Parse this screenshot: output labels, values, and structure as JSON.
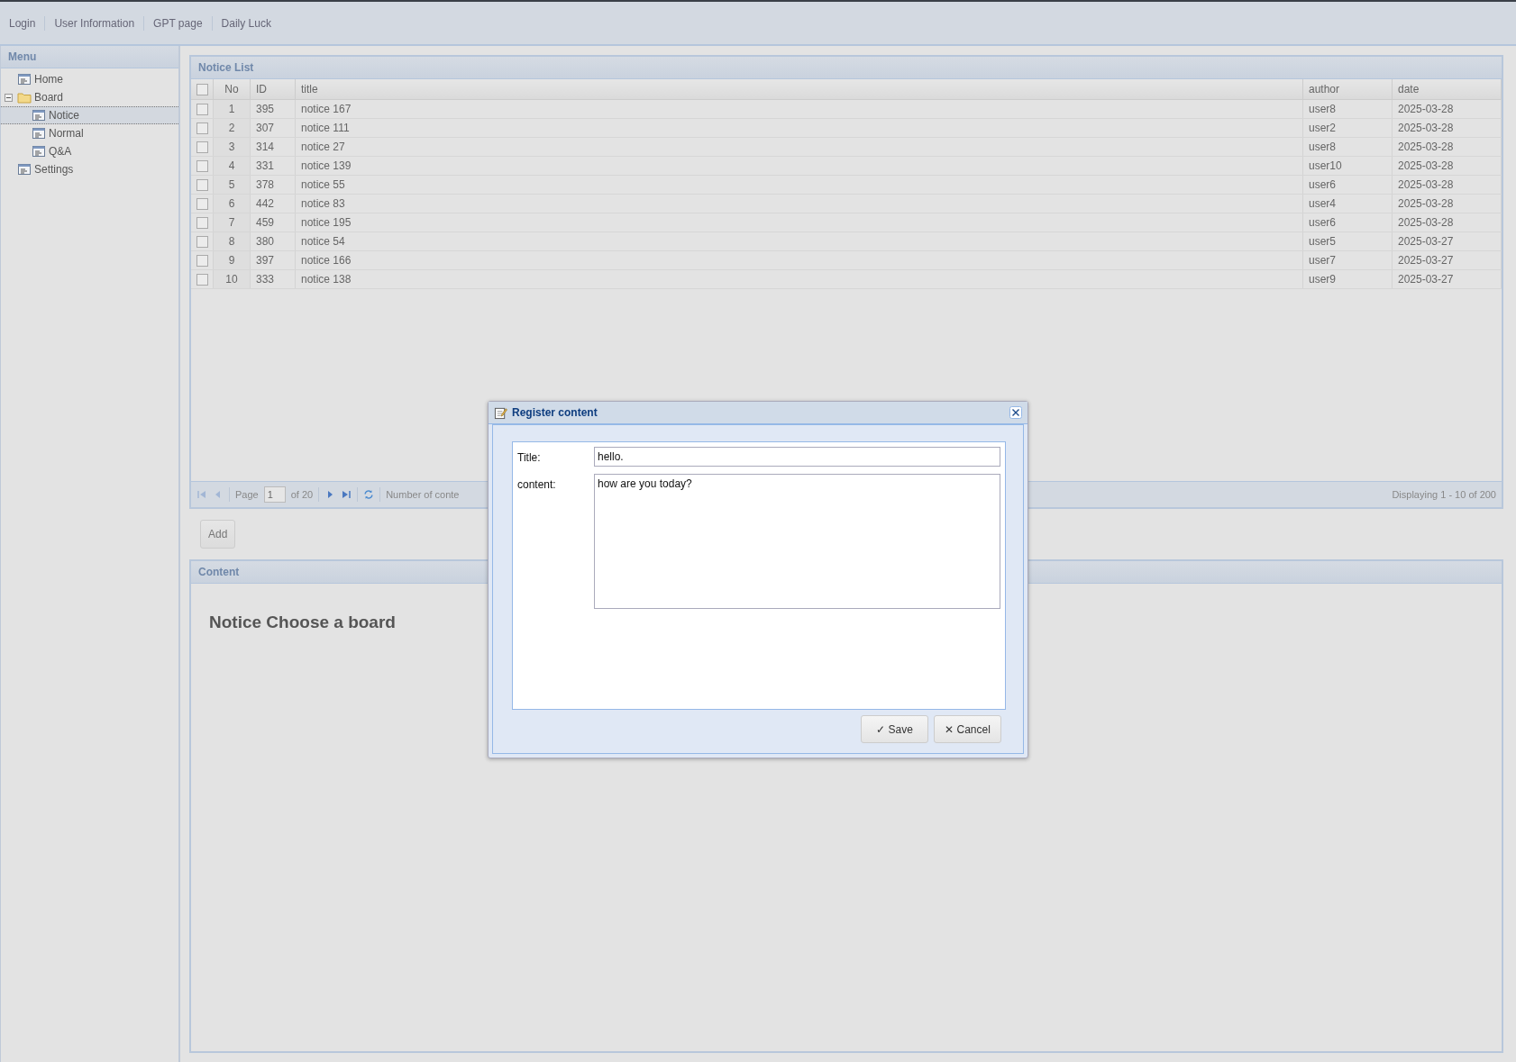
{
  "top_nav": [
    "Login",
    "User Information",
    "GPT page",
    "Daily Luck"
  ],
  "menu": {
    "title": "Menu",
    "items": [
      {
        "label": "Home",
        "selected": false
      },
      {
        "label": "Board",
        "selected": false,
        "expanded": true,
        "children": [
          {
            "label": "Notice",
            "selected": true
          },
          {
            "label": "Normal",
            "selected": false
          },
          {
            "label": "Q&A",
            "selected": false
          }
        ]
      },
      {
        "label": "Settings",
        "selected": false
      }
    ]
  },
  "notice_list": {
    "title": "Notice List",
    "all_checked": false,
    "columns": [
      "No",
      "ID",
      "title",
      "author",
      "date"
    ],
    "rows": [
      {
        "checked": false,
        "cells": [
          "1",
          "395",
          "notice 167",
          "user8",
          "2025-03-28"
        ]
      },
      {
        "checked": false,
        "cells": [
          "2",
          "307",
          "notice 111",
          "user2",
          "2025-03-28"
        ]
      },
      {
        "checked": false,
        "cells": [
          "3",
          "314",
          "notice 27",
          "user8",
          "2025-03-28"
        ]
      },
      {
        "checked": false,
        "cells": [
          "4",
          "331",
          "notice 139",
          "user10",
          "2025-03-28"
        ]
      },
      {
        "checked": false,
        "cells": [
          "5",
          "378",
          "notice 55",
          "user6",
          "2025-03-28"
        ]
      },
      {
        "checked": false,
        "cells": [
          "6",
          "442",
          "notice 83",
          "user4",
          "2025-03-28"
        ]
      },
      {
        "checked": false,
        "cells": [
          "7",
          "459",
          "notice 195",
          "user6",
          "2025-03-28"
        ]
      },
      {
        "checked": false,
        "cells": [
          "8",
          "380",
          "notice 54",
          "user5",
          "2025-03-27"
        ]
      },
      {
        "checked": false,
        "cells": [
          "9",
          "397",
          "notice 166",
          "user7",
          "2025-03-27"
        ]
      },
      {
        "checked": false,
        "cells": [
          "10",
          "333",
          "notice 138",
          "user9",
          "2025-03-27"
        ]
      }
    ],
    "pager": {
      "at_first": true,
      "page_label": "Page",
      "page": "1",
      "of": "of 20",
      "count_label": "Number of conte",
      "display": "Displaying 1 - 10 of 200"
    }
  },
  "add_button": "Add",
  "content": {
    "title": "Content",
    "heading": "Notice Choose a board"
  },
  "dialog": {
    "title": "Register content",
    "fields": [
      {
        "kind": "line",
        "label": "Title:",
        "value": "hello."
      },
      {
        "kind": "area",
        "label": "content:",
        "value": "how are you today?"
      }
    ],
    "buttons": [
      "✓ Save",
      "✕ Cancel"
    ]
  }
}
